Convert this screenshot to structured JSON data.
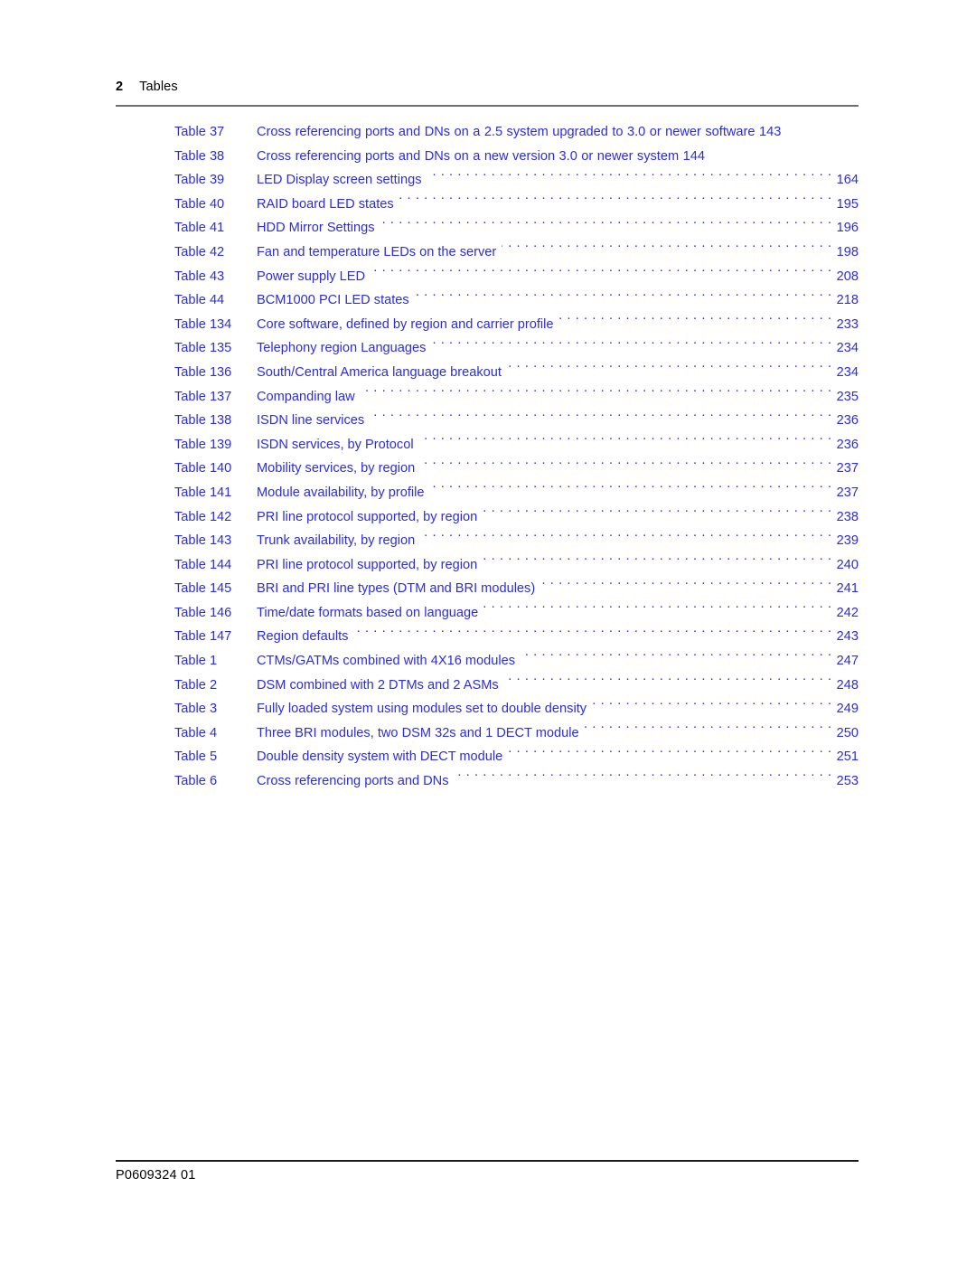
{
  "header": {
    "folio": "2",
    "chapter_name": "Tables"
  },
  "colors": {
    "link": "#2b2be8",
    "header_rule": "#6e6e6e",
    "footer_rule": "#1a1a1a",
    "body_text": "#000000",
    "page_background": "#ffffff"
  },
  "list_of_tables": [
    {
      "label": "Table 37",
      "title": "Cross referencing ports and DNs on a 2.5 system upgraded to 3.0 or newer software",
      "page": "143",
      "leader": false,
      "inline": "Cross referencing ports and DNs on a 2.5 system upgraded to 3.0 or newer software 143"
    },
    {
      "label": "Table 38",
      "title": "Cross referencing ports and DNs on a new version 3.0 or newer system",
      "page": "144",
      "leader": false,
      "inline": "Cross referencing ports and DNs on a new version 3.0 or newer system 144"
    },
    {
      "label": "Table 39",
      "title": "LED Display screen settings",
      "page": "164",
      "leader": true
    },
    {
      "label": "Table 40",
      "title": "RAID board LED states",
      "page": "195",
      "leader": true
    },
    {
      "label": "Table 41",
      "title": "HDD Mirror Settings",
      "page": "196",
      "leader": true
    },
    {
      "label": "Table 42",
      "title": "Fan and temperature LEDs on the server",
      "page": "198",
      "leader": true
    },
    {
      "label": "Table 43",
      "title": "Power supply LED",
      "page": "208",
      "leader": true
    },
    {
      "label": "Table 44",
      "title": "BCM1000 PCI LED states",
      "page": "218",
      "leader": true
    },
    {
      "label": "Table 134",
      "title": "Core software, defined by region and carrier profile",
      "page": "233",
      "leader": true
    },
    {
      "label": "Table 135",
      "title": "Telephony region Languages",
      "page": "234",
      "leader": true
    },
    {
      "label": "Table 136",
      "title": "South/Central America language breakout",
      "page": "234",
      "leader": true
    },
    {
      "label": "Table 137",
      "title": "Companding law",
      "page": "235",
      "leader": true
    },
    {
      "label": "Table 138",
      "title": "ISDN line services",
      "page": "236",
      "leader": true
    },
    {
      "label": "Table 139",
      "title": "ISDN services, by Protocol",
      "page": "236",
      "leader": true
    },
    {
      "label": "Table 140",
      "title": "Mobility services, by region",
      "page": "237",
      "leader": true
    },
    {
      "label": "Table 141",
      "title": "Module availability, by profile",
      "page": "237",
      "leader": true
    },
    {
      "label": "Table 142",
      "title": "PRI line protocol supported, by region",
      "page": "238",
      "leader": true
    },
    {
      "label": "Table 143",
      "title": "Trunk availability, by region",
      "page": "239",
      "leader": true
    },
    {
      "label": "Table 144",
      "title": "PRI line protocol supported, by region",
      "page": "240",
      "leader": true
    },
    {
      "label": "Table 145",
      "title": "BRI and PRI line types (DTM and BRI modules)",
      "page": "241",
      "leader": true
    },
    {
      "label": "Table 146",
      "title": "Time/date formats based on language",
      "page": "242",
      "leader": true
    },
    {
      "label": "Table 147",
      "title": "Region defaults",
      "page": "243",
      "leader": true
    },
    {
      "label": "Table 1",
      "title": "CTMs/GATMs combined with 4X16 modules",
      "page": "247",
      "leader": true
    },
    {
      "label": "Table 2",
      "title": "DSM combined with 2 DTMs and 2 ASMs",
      "page": "248",
      "leader": true
    },
    {
      "label": "Table 3",
      "title": "Fully loaded system using modules set to double density",
      "page": "249",
      "leader": true
    },
    {
      "label": "Table 4",
      "title": "Three BRI modules, two DSM 32s and 1 DECT module",
      "page": "250",
      "leader": true
    },
    {
      "label": "Table 5",
      "title": "Double density system with DECT module",
      "page": "251",
      "leader": true
    },
    {
      "label": "Table 6",
      "title": "Cross referencing ports and DNs",
      "page": "253",
      "leader": true
    }
  ],
  "footer": {
    "document_number": "P0609324  01"
  }
}
